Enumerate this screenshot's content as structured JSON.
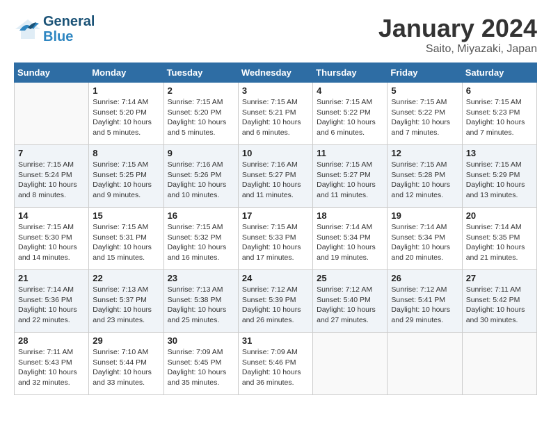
{
  "logo": {
    "line1": "General",
    "line2": "Blue"
  },
  "title": "January 2024",
  "subtitle": "Saito, Miyazaki, Japan",
  "days_of_week": [
    "Sunday",
    "Monday",
    "Tuesday",
    "Wednesday",
    "Thursday",
    "Friday",
    "Saturday"
  ],
  "weeks": [
    [
      {
        "day": "",
        "info": ""
      },
      {
        "day": "1",
        "info": "Sunrise: 7:14 AM\nSunset: 5:20 PM\nDaylight: 10 hours\nand 5 minutes."
      },
      {
        "day": "2",
        "info": "Sunrise: 7:15 AM\nSunset: 5:20 PM\nDaylight: 10 hours\nand 5 minutes."
      },
      {
        "day": "3",
        "info": "Sunrise: 7:15 AM\nSunset: 5:21 PM\nDaylight: 10 hours\nand 6 minutes."
      },
      {
        "day": "4",
        "info": "Sunrise: 7:15 AM\nSunset: 5:22 PM\nDaylight: 10 hours\nand 6 minutes."
      },
      {
        "day": "5",
        "info": "Sunrise: 7:15 AM\nSunset: 5:22 PM\nDaylight: 10 hours\nand 7 minutes."
      },
      {
        "day": "6",
        "info": "Sunrise: 7:15 AM\nSunset: 5:23 PM\nDaylight: 10 hours\nand 7 minutes."
      }
    ],
    [
      {
        "day": "7",
        "info": "Sunrise: 7:15 AM\nSunset: 5:24 PM\nDaylight: 10 hours\nand 8 minutes."
      },
      {
        "day": "8",
        "info": "Sunrise: 7:15 AM\nSunset: 5:25 PM\nDaylight: 10 hours\nand 9 minutes."
      },
      {
        "day": "9",
        "info": "Sunrise: 7:16 AM\nSunset: 5:26 PM\nDaylight: 10 hours\nand 10 minutes."
      },
      {
        "day": "10",
        "info": "Sunrise: 7:16 AM\nSunset: 5:27 PM\nDaylight: 10 hours\nand 11 minutes."
      },
      {
        "day": "11",
        "info": "Sunrise: 7:15 AM\nSunset: 5:27 PM\nDaylight: 10 hours\nand 11 minutes."
      },
      {
        "day": "12",
        "info": "Sunrise: 7:15 AM\nSunset: 5:28 PM\nDaylight: 10 hours\nand 12 minutes."
      },
      {
        "day": "13",
        "info": "Sunrise: 7:15 AM\nSunset: 5:29 PM\nDaylight: 10 hours\nand 13 minutes."
      }
    ],
    [
      {
        "day": "14",
        "info": "Sunrise: 7:15 AM\nSunset: 5:30 PM\nDaylight: 10 hours\nand 14 minutes."
      },
      {
        "day": "15",
        "info": "Sunrise: 7:15 AM\nSunset: 5:31 PM\nDaylight: 10 hours\nand 15 minutes."
      },
      {
        "day": "16",
        "info": "Sunrise: 7:15 AM\nSunset: 5:32 PM\nDaylight: 10 hours\nand 16 minutes."
      },
      {
        "day": "17",
        "info": "Sunrise: 7:15 AM\nSunset: 5:33 PM\nDaylight: 10 hours\nand 17 minutes."
      },
      {
        "day": "18",
        "info": "Sunrise: 7:14 AM\nSunset: 5:34 PM\nDaylight: 10 hours\nand 19 minutes."
      },
      {
        "day": "19",
        "info": "Sunrise: 7:14 AM\nSunset: 5:34 PM\nDaylight: 10 hours\nand 20 minutes."
      },
      {
        "day": "20",
        "info": "Sunrise: 7:14 AM\nSunset: 5:35 PM\nDaylight: 10 hours\nand 21 minutes."
      }
    ],
    [
      {
        "day": "21",
        "info": "Sunrise: 7:14 AM\nSunset: 5:36 PM\nDaylight: 10 hours\nand 22 minutes."
      },
      {
        "day": "22",
        "info": "Sunrise: 7:13 AM\nSunset: 5:37 PM\nDaylight: 10 hours\nand 23 minutes."
      },
      {
        "day": "23",
        "info": "Sunrise: 7:13 AM\nSunset: 5:38 PM\nDaylight: 10 hours\nand 25 minutes."
      },
      {
        "day": "24",
        "info": "Sunrise: 7:12 AM\nSunset: 5:39 PM\nDaylight: 10 hours\nand 26 minutes."
      },
      {
        "day": "25",
        "info": "Sunrise: 7:12 AM\nSunset: 5:40 PM\nDaylight: 10 hours\nand 27 minutes."
      },
      {
        "day": "26",
        "info": "Sunrise: 7:12 AM\nSunset: 5:41 PM\nDaylight: 10 hours\nand 29 minutes."
      },
      {
        "day": "27",
        "info": "Sunrise: 7:11 AM\nSunset: 5:42 PM\nDaylight: 10 hours\nand 30 minutes."
      }
    ],
    [
      {
        "day": "28",
        "info": "Sunrise: 7:11 AM\nSunset: 5:43 PM\nDaylight: 10 hours\nand 32 minutes."
      },
      {
        "day": "29",
        "info": "Sunrise: 7:10 AM\nSunset: 5:44 PM\nDaylight: 10 hours\nand 33 minutes."
      },
      {
        "day": "30",
        "info": "Sunrise: 7:09 AM\nSunset: 5:45 PM\nDaylight: 10 hours\nand 35 minutes."
      },
      {
        "day": "31",
        "info": "Sunrise: 7:09 AM\nSunset: 5:46 PM\nDaylight: 10 hours\nand 36 minutes."
      },
      {
        "day": "",
        "info": ""
      },
      {
        "day": "",
        "info": ""
      },
      {
        "day": "",
        "info": ""
      }
    ]
  ]
}
